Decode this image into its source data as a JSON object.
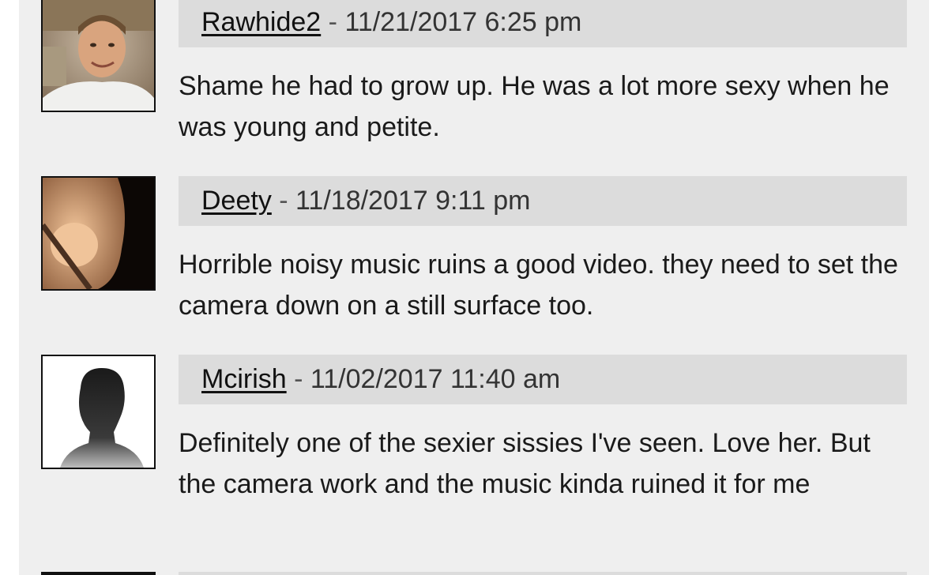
{
  "comments": [
    {
      "author": "Rawhide2",
      "separator": " - ",
      "timestamp": "11/21/2017 6:25 pm",
      "text": "Shame he had to grow up. He was a lot more sexy when he was young and petite.",
      "avatar": "user-photo-avatar"
    },
    {
      "author": "Deety",
      "separator": " - ",
      "timestamp": "11/18/2017 9:11 pm",
      "text": "Horrible noisy music ruins a good video. they need to set the camera down on a still surface too.",
      "avatar": "user-photo-avatar"
    },
    {
      "author": "Mcirish",
      "separator": " - ",
      "timestamp": "11/02/2017 11:40 am",
      "text": "Definitely one of the sexier sissies I've seen. Love her. But the camera work and the music kinda ruined it for me",
      "avatar": "default-silhouette-avatar"
    }
  ],
  "colors": {
    "page_background": "#ffffff",
    "panel_background": "#efefef",
    "header_background": "#dcdcdc",
    "text": "#1a1a1a",
    "avatar_border": "#111111"
  }
}
